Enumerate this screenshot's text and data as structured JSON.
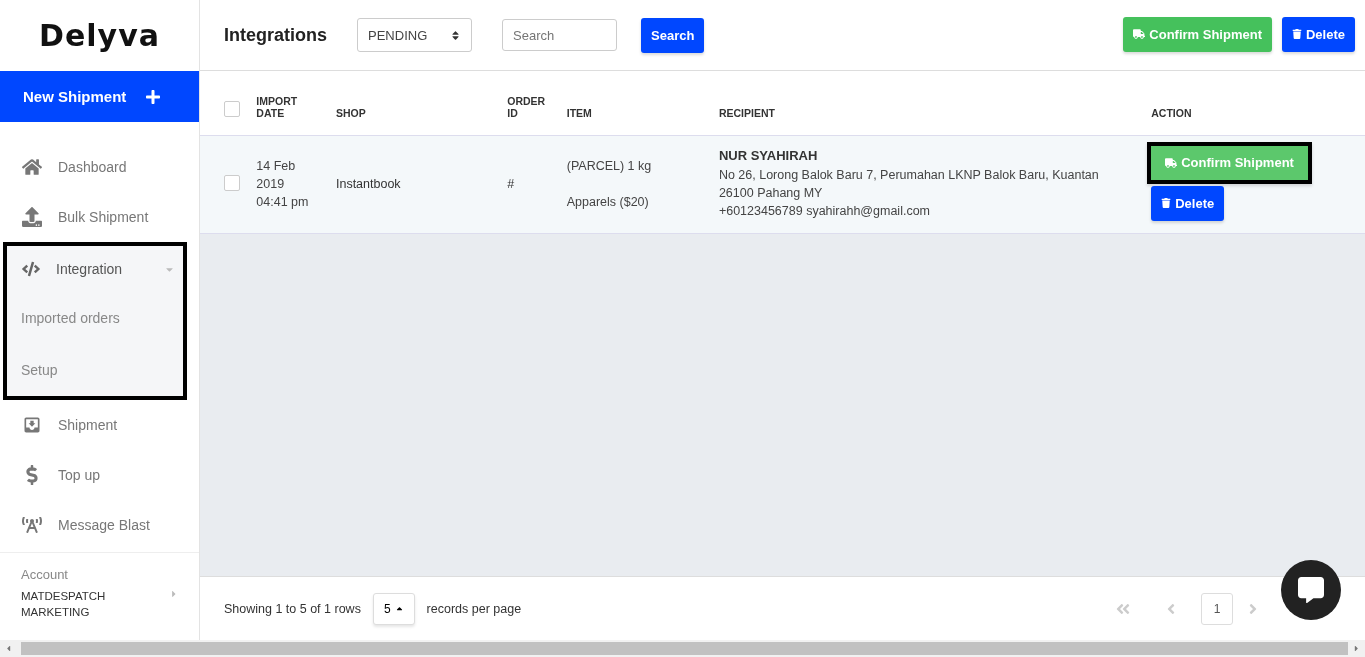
{
  "logo": "Delyva",
  "new_shipment": {
    "label": "New Shipment"
  },
  "nav": [
    {
      "kind": "link",
      "label": "Dashboard"
    },
    {
      "kind": "link",
      "label": "Bulk Shipment"
    },
    {
      "kind": "group",
      "label": "Integration",
      "expanded": true,
      "highlighted": true,
      "children": [
        {
          "label": "Imported orders"
        },
        {
          "label": "Setup"
        }
      ]
    },
    {
      "kind": "link",
      "label": "Shipment"
    },
    {
      "kind": "link",
      "label": "Top up"
    },
    {
      "kind": "link",
      "label": "Message Blast"
    }
  ],
  "account": {
    "label": "Account",
    "name": "MATDESPATCH MARKETING"
  },
  "header": {
    "title": "Integrations",
    "status_select": "PENDING",
    "search_placeholder": "Search",
    "search_button": "Search",
    "confirm_button": "Confirm Shipment",
    "delete_button": "Delete"
  },
  "table": {
    "all_checked": false,
    "columns": [
      "IMPORT DATE",
      "SHOP",
      "ORDER ID",
      "ITEM",
      "RECIPIENT",
      "ACTION"
    ],
    "rows": [
      {
        "checked": false,
        "date": "14 Feb 2019 04:41 pm",
        "shop": "Instantbook",
        "order_id": "#",
        "item": "(PARCEL) 1 kg",
        "item_desc": "Apparels ($20)",
        "recipient_name": "NUR SYAHIRAH",
        "address": "No 26, Lorong Balok Baru 7, Perumahan LKNP Balok Baru, Kuantan 26100 Pahang MY",
        "contact": "+60123456789 syahirahh@gmail.com",
        "confirm_button": "Confirm Shipment",
        "confirm_highlighted": true,
        "delete_button": "Delete"
      }
    ]
  },
  "footer": {
    "showing": "Showing 1 to 5 of 1 rows",
    "page_size": "5",
    "per_page": "records per page",
    "pages": [
      {
        "label": "1",
        "selected": true
      }
    ]
  }
}
